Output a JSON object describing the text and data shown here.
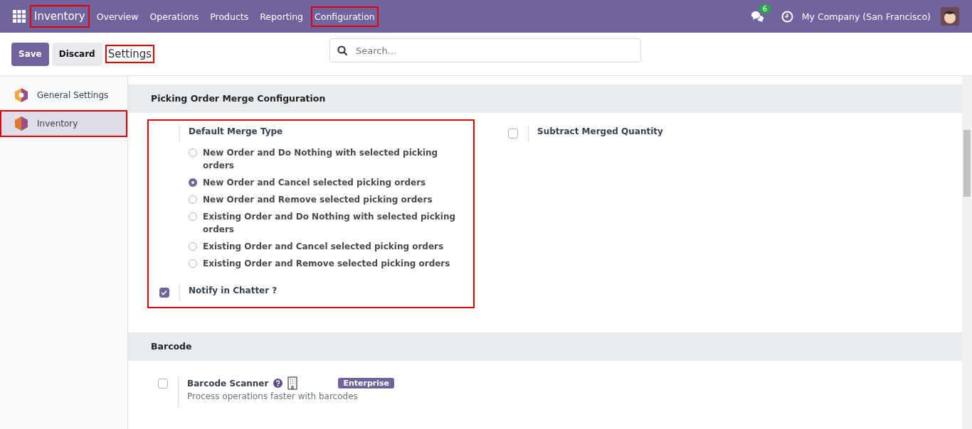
{
  "navbar": {
    "brand": {
      "label": "Inventory",
      "highlighted": true
    },
    "menu": [
      {
        "label": "Overview",
        "highlighted": false
      },
      {
        "label": "Operations",
        "highlighted": false
      },
      {
        "label": "Products",
        "highlighted": false
      },
      {
        "label": "Reporting",
        "highlighted": false
      },
      {
        "label": "Configuration",
        "highlighted": true
      }
    ],
    "message_count": "6",
    "company": "My Company (San Francisco)"
  },
  "control_panel": {
    "buttons": [
      {
        "label": "Save",
        "kind": "primary"
      },
      {
        "label": "Discard",
        "kind": "secondary"
      }
    ],
    "title": {
      "label": "Settings",
      "highlighted": true
    },
    "search": {
      "placeholder": "Search..."
    }
  },
  "sidebar": {
    "items": [
      {
        "label": "General Settings",
        "selected": false,
        "highlighted": false
      },
      {
        "label": "Inventory",
        "selected": true,
        "highlighted": true
      }
    ]
  },
  "sections": [
    {
      "title": "Picking Order Merge Configuration",
      "highlighted": true,
      "merge_type": {
        "label": "Default Merge Type",
        "options": [
          {
            "label": "New Order and Do Nothing with selected picking orders",
            "selected": false
          },
          {
            "label": "New Order and Cancel selected picking orders",
            "selected": true
          },
          {
            "label": "New Order and Remove selected picking orders",
            "selected": false
          },
          {
            "label": "Existing Order and Do Nothing with selected picking orders",
            "selected": false
          },
          {
            "label": "Existing Order and Cancel selected picking orders",
            "selected": false
          },
          {
            "label": "Existing Order and Remove selected picking orders",
            "selected": false
          }
        ]
      },
      "notify": {
        "label": "Notify in Chatter ?",
        "checked": true
      },
      "subtract": {
        "label": "Subtract Merged Quantity",
        "checked": false
      }
    },
    {
      "title": "Barcode",
      "settings": [
        {
          "label": "Barcode Scanner",
          "description": "Process operations faster with barcodes",
          "checked": false,
          "badge": "Enterprise"
        }
      ]
    }
  ]
}
